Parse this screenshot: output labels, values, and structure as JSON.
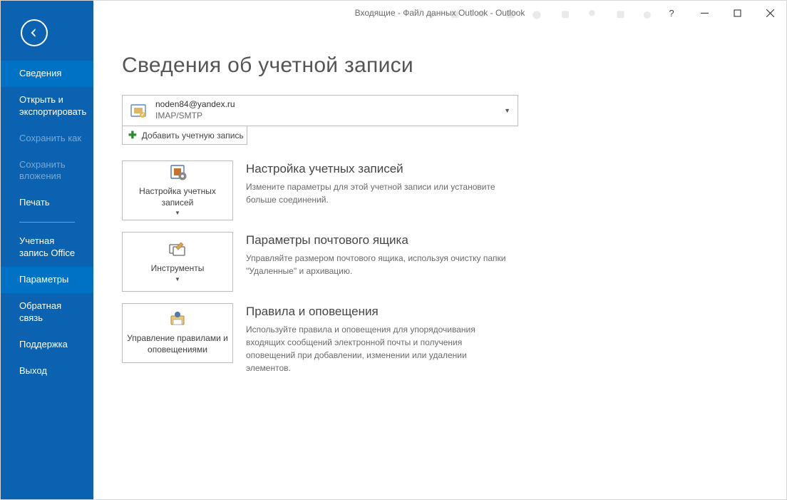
{
  "window_title": "Входящие - Файл данных Outlook - Outlook",
  "sidebar": {
    "items": [
      {
        "label": "Сведения",
        "state": "active"
      },
      {
        "label": "Открыть и экспортировать",
        "state": "normal"
      },
      {
        "label": "Сохранить как",
        "state": "disabled"
      },
      {
        "label": "Сохранить вложения",
        "state": "disabled"
      },
      {
        "label": "Печать",
        "state": "normal"
      },
      {
        "label": "Учетная запись Office",
        "state": "normal"
      },
      {
        "label": "Параметры",
        "state": "active"
      },
      {
        "label": "Обратная связь",
        "state": "normal"
      },
      {
        "label": "Поддержка",
        "state": "normal"
      },
      {
        "label": "Выход",
        "state": "normal"
      }
    ]
  },
  "page_title": "Сведения об учетной записи",
  "account": {
    "email": "noden84@yandex.ru",
    "protocol": "IMAP/SMTP"
  },
  "add_account_label": "Добавить учетную запись",
  "sections": [
    {
      "tile_label": "Настройка учетных записей",
      "title": "Настройка учетных записей",
      "desc": "Измените параметры для этой учетной записи или установите больше соединений.",
      "has_dropdown": true
    },
    {
      "tile_label": "Инструменты",
      "title": "Параметры почтового ящика",
      "desc": "Управляйте размером почтового ящика, используя очистку папки \"Удаленные\" и архивацию.",
      "has_dropdown": true
    },
    {
      "tile_label": "Управление правилами и оповещениями",
      "title": "Правила и оповещения",
      "desc": "Используйте правила и оповещения для упорядочивания входящих сообщений электронной почты и получения оповещений при добавлении, изменении или удалении элементов.",
      "has_dropdown": false
    }
  ],
  "help_label": "?"
}
